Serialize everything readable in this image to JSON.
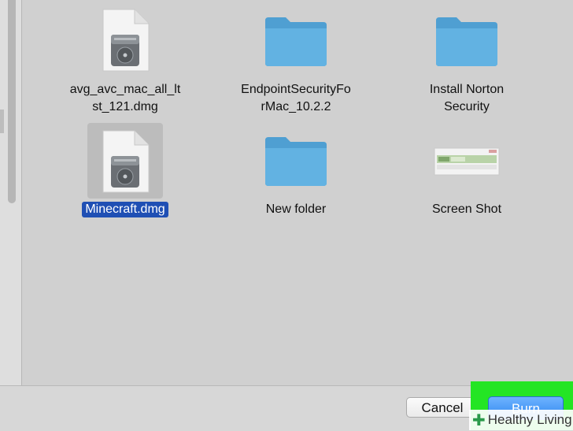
{
  "files": [
    {
      "name_line1": "avg_avc_mac_all_lt",
      "name_line2": "st_121.dmg",
      "icon": "disk-image-icon"
    },
    {
      "name_line1": "EndpointSecurityFo",
      "name_line2": "rMac_10.2.2",
      "icon": "folder-icon"
    },
    {
      "name_line1": "Install Norton",
      "name_line2": "Security",
      "icon": "folder-icon"
    },
    {
      "name_line1": "Minecraft.dmg",
      "icon": "disk-image-icon",
      "selected": true
    },
    {
      "name_line1": "New folder",
      "icon": "folder-icon"
    },
    {
      "name_line1": "Screen Shot",
      "icon": "screenshot-thumbnail-icon"
    }
  ],
  "buttons": {
    "cancel": "Cancel",
    "burn": "Burn"
  },
  "watermark": {
    "text": "Healthy Living"
  },
  "colors": {
    "selection": "#1f4fb4",
    "folder": "#5aa9d9",
    "primary_button": "#3a8ff3",
    "highlight": "#24e524"
  }
}
